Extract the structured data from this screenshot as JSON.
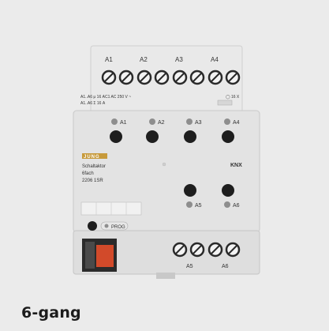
{
  "caption": "6-gang",
  "device": {
    "terminal_labels_top": [
      "A1",
      "A2",
      "A3",
      "A4"
    ],
    "terminal_labels_bottom": [
      "A5",
      "A6"
    ],
    "spec_line_1": "A1..A6  μ 16 AC1  AC 250 V ~",
    "spec_line_2": "A1..A6  Σ 16 A",
    "spec_right": "◯ 16 X",
    "channel_labels": [
      "A1",
      "A2",
      "A3",
      "A4"
    ],
    "channel_labels_lower": [
      "A5",
      "A6"
    ],
    "brand": "JUNG",
    "product_line_1": "Schaltaktor",
    "product_line_2": "6fach",
    "product_line_3": "2206 1SR",
    "knx": "KNX",
    "prog_label": "PROG",
    "colors": {
      "housing": "#e3e3e3",
      "terminal_orange": "#d24a2a",
      "led": "#8e8e8e",
      "button": "#1e1e1e"
    }
  }
}
